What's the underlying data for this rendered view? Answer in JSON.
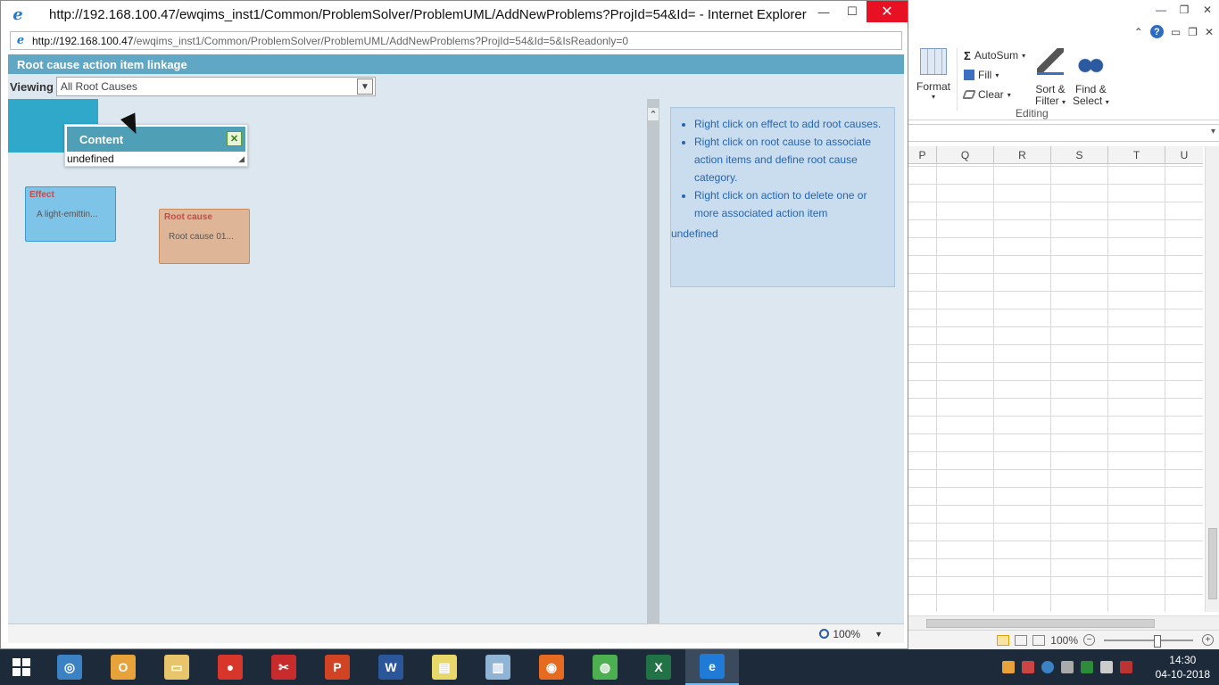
{
  "ie": {
    "title": "http://192.168.100.47/ewqims_inst1/Common/ProblemSolver/ProblemUML/AddNewProblems?ProjId=54&Id= - Internet Explorer",
    "address_host": "http://192.168.100.47",
    "address_path": "/ewqims_inst1/Common/ProblemSolver/ProblemUML/AddNewProblems?ProjId=54&Id=5&IsReadonly=0",
    "minimize": "—",
    "maximize": "☐",
    "close": "✕"
  },
  "panel": {
    "header": "Root cause action item linkage",
    "viewing_label": "Viewing",
    "viewing_value": "All Root Causes"
  },
  "tooltip": {
    "title": "Content",
    "body": "undefined"
  },
  "nodes": {
    "effect": {
      "header": "Effect",
      "text": "A light-emittin..."
    },
    "root_cause": {
      "header": "Root cause",
      "text": "Root cause 01..."
    }
  },
  "help": {
    "items": [
      "Right click on effect to add root causes.",
      "Right click on root cause to associate action items and define root cause category.",
      "Right click on action to delete one or more associated action item"
    ],
    "footer": "undefined"
  },
  "status": {
    "zoom": "100%"
  },
  "excel": {
    "ribbon": {
      "format": "Format",
      "autosum": "AutoSum",
      "fill": "Fill",
      "clear": "Clear",
      "sort_filter": "Sort &",
      "sort_filter2": "Filter",
      "find_select": "Find &",
      "find_select2": "Select",
      "group_label": "Editing"
    },
    "columns": [
      "P",
      "Q",
      "R",
      "S",
      "T",
      "U"
    ],
    "zoom": "100%"
  },
  "taskbar": {
    "time": "14:30",
    "date": "04-10-2018",
    "apps": [
      {
        "name": "safari",
        "color": "#3b82c4",
        "glyph": "◎"
      },
      {
        "name": "outlook",
        "color": "#e8a23a",
        "glyph": "O"
      },
      {
        "name": "file-explorer",
        "color": "#e8c56a",
        "glyph": "▭"
      },
      {
        "name": "camera",
        "color": "#d9362b",
        "glyph": "●"
      },
      {
        "name": "snip",
        "color": "#c82b2b",
        "glyph": "✂"
      },
      {
        "name": "powerpoint",
        "color": "#d04424",
        "glyph": "P"
      },
      {
        "name": "word",
        "color": "#2b579a",
        "glyph": "W"
      },
      {
        "name": "sticky",
        "color": "#e8d86a",
        "glyph": "▤"
      },
      {
        "name": "notes",
        "color": "#8fb4d6",
        "glyph": "▥"
      },
      {
        "name": "firefox",
        "color": "#e66a1f",
        "glyph": "◉"
      },
      {
        "name": "chrome",
        "color": "#4caf50",
        "glyph": "◍"
      },
      {
        "name": "excel",
        "color": "#217346",
        "glyph": "X"
      },
      {
        "name": "internet-explorer",
        "color": "#1f7bd6",
        "glyph": "e"
      }
    ]
  }
}
